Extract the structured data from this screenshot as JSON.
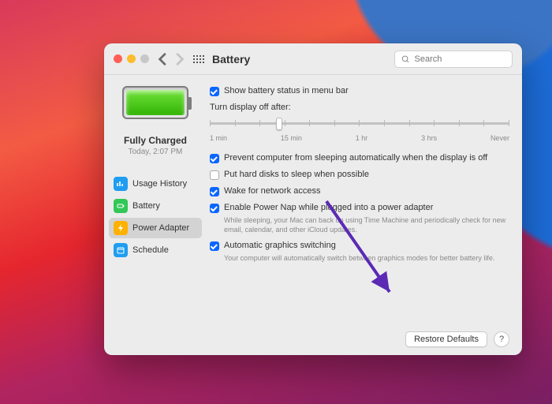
{
  "window": {
    "title": "Battery"
  },
  "search": {
    "placeholder": "Search"
  },
  "sidebar": {
    "status_title": "Fully Charged",
    "status_time": "Today, 2:07 PM",
    "items": [
      {
        "label": "Usage History",
        "color": "#1f9df1"
      },
      {
        "label": "Battery",
        "color": "#33c758"
      },
      {
        "label": "Power Adapter",
        "color": "#ffb100"
      },
      {
        "label": "Schedule",
        "color": "#1f9df1"
      }
    ]
  },
  "settings": {
    "show_menu_bar": {
      "label": "Show battery status in menu bar",
      "checked": true
    },
    "slider_title": "Turn display off after:",
    "slider_labels": [
      "1 min",
      "15 min",
      "1 hr",
      "3 hrs",
      "Never"
    ],
    "prevent_sleep": {
      "label": "Prevent computer from sleeping automatically when the display is off",
      "checked": true
    },
    "hard_disks": {
      "label": "Put hard disks to sleep when possible",
      "checked": false
    },
    "wake_network": {
      "label": "Wake for network access",
      "checked": true
    },
    "power_nap": {
      "label": "Enable Power Nap while plugged into a power adapter",
      "checked": true,
      "desc": "While sleeping, your Mac can back up using Time Machine and periodically check for new email, calendar, and other iCloud updates."
    },
    "auto_graphics": {
      "label": "Automatic graphics switching",
      "checked": true,
      "desc": "Your computer will automatically switch between graphics modes for better battery life."
    }
  },
  "footer": {
    "restore": "Restore Defaults",
    "help": "?"
  }
}
